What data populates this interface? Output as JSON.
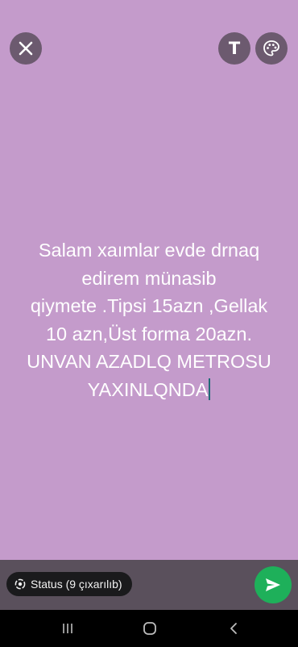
{
  "status_editor": {
    "background_color": "#c49bcb",
    "text": "Salam xaımlar evde drnaq\nedirem münasib\nqiymete .Tipsi 15azn ,Gellak\n10 azn,Üst forma 20azn.\nUNVAN AZADLQ METROSU\nYAXINLQNDA",
    "text_color": "#ffffff"
  },
  "toolbar": {
    "close_icon": "close-icon",
    "text_tool_label": "T",
    "palette_icon": "palette-icon"
  },
  "footer": {
    "status_audience_label": "Status (9 çıxarılıb)",
    "status_icon": "status-ring-icon",
    "send_icon": "send-icon",
    "send_color": "#1eb05a"
  },
  "system_nav": {
    "recents_icon": "recents-icon",
    "home_icon": "home-icon",
    "back_icon": "back-icon"
  }
}
